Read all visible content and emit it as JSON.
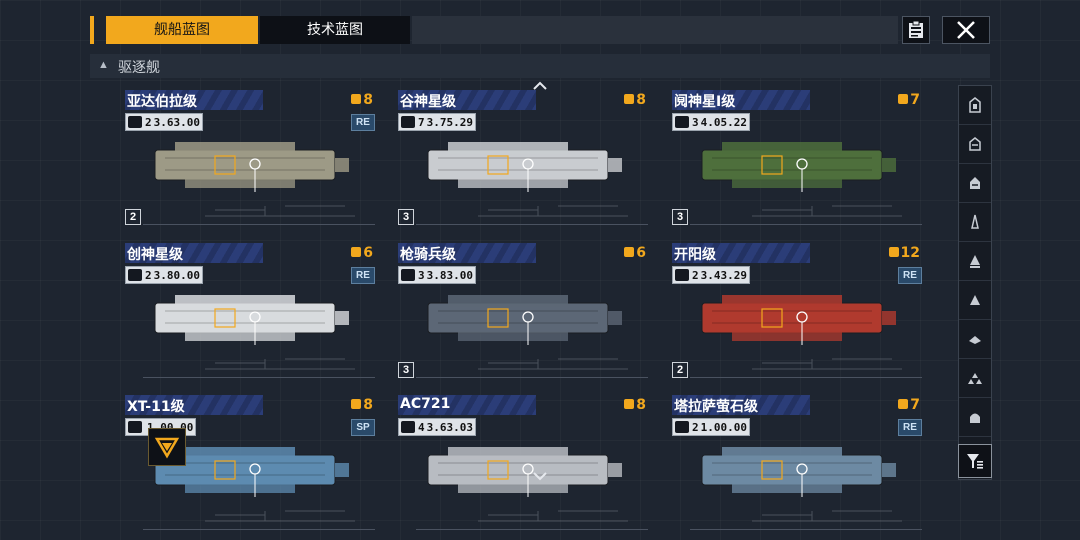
{
  "tabs": [
    {
      "label": "舰船蓝图",
      "active": true
    },
    {
      "label": "技术蓝图",
      "active": false
    }
  ],
  "section": {
    "label": "驱逐舰"
  },
  "ships": [
    {
      "name": "亚达伯拉级",
      "level": "8",
      "stat_rank": "2",
      "stat_value": "3.63.00",
      "tag": "RE",
      "rank": "2",
      "hull_color": "#9d9a86"
    },
    {
      "name": "谷神星级",
      "level": "8",
      "stat_rank": "7",
      "stat_value": "3.75.29",
      "tag": "",
      "rank": "3",
      "hull_color": "#c9ccd0"
    },
    {
      "name": "阋神星I级",
      "level": "7",
      "stat_rank": "3",
      "stat_value": "4.05.22",
      "tag": "",
      "rank": "3",
      "hull_color": "#4e6f3c"
    },
    {
      "name": "创神星级",
      "level": "6",
      "stat_rank": "2",
      "stat_value": "3.80.00",
      "tag": "RE",
      "rank": "",
      "hull_color": "#d8dbde"
    },
    {
      "name": "枪骑兵级",
      "level": "6",
      "stat_rank": "3",
      "stat_value": "3.83.00",
      "tag": "",
      "rank": "3",
      "hull_color": "#5c6776"
    },
    {
      "name": "开阳级",
      "level": "12",
      "stat_rank": "2",
      "stat_value": "3.43.29",
      "tag": "RE",
      "rank": "2",
      "hull_color": "#b03a2e"
    },
    {
      "name": "XT-11级",
      "level": "8",
      "stat_rank": "",
      "stat_value": "1.00.00",
      "tag": "SP",
      "rank": "",
      "hull_color": "#5d8bb0"
    },
    {
      "name": "AC721",
      "level": "8",
      "stat_rank": "4",
      "stat_value": "3.63.03",
      "tag": "",
      "rank": "",
      "hull_color": "#b8bcc2"
    },
    {
      "name": "塔拉萨萤石级",
      "level": "7",
      "stat_rank": "2",
      "stat_value": "1.00.00",
      "tag": "RE",
      "rank": "",
      "hull_color": "#6d8aa3"
    }
  ],
  "colors": {
    "accent": "#f2a81d",
    "namebar": "#2b3d78",
    "tag_bg": "#2a4a6a"
  },
  "sidebar_icons": [
    "carrier-icon",
    "cruiser-icon",
    "battleship-icon",
    "frigate-icon",
    "destroyer-icon",
    "corvette-icon",
    "aircraft-icon",
    "support-icon",
    "base-icon"
  ]
}
